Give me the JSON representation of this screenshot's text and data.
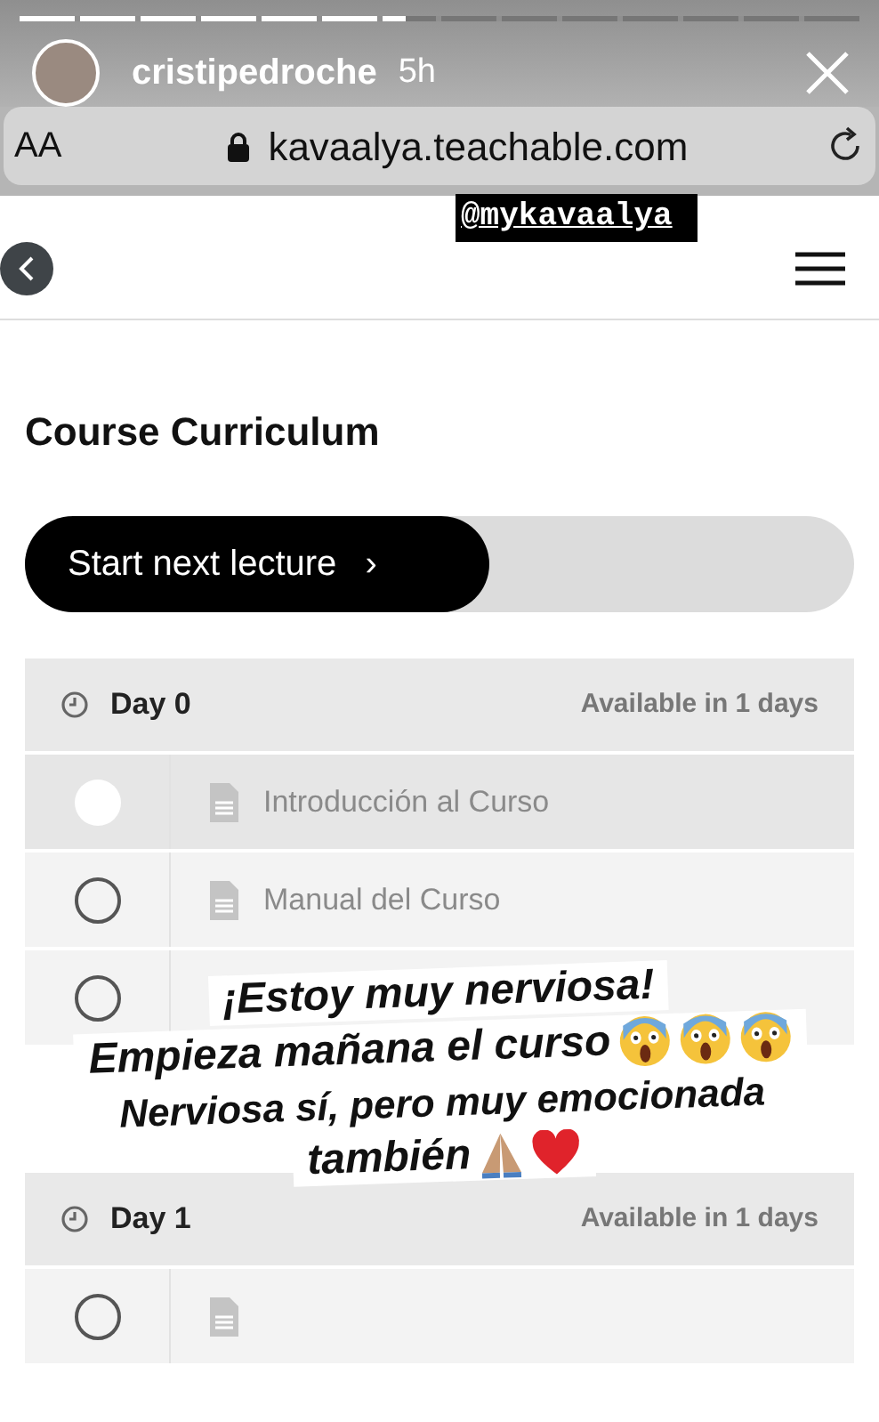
{
  "story": {
    "progress": {
      "level": 0.46
    },
    "username": "cristipedroche",
    "time": "5h"
  },
  "browser": {
    "text_size": "AA",
    "url": "kavaalya.teachable.com"
  },
  "sticker": "@mykavaalya",
  "title": "Course Curriculum",
  "start_button": {
    "label": "Start next lecture",
    "arrow": "›",
    "level": 0.56
  },
  "sections": [
    {
      "name": "Day 0",
      "availability": "Available in 1 days",
      "lectures": [
        {
          "title": "Introducción al Curso",
          "selected": true
        },
        {
          "title": "Manual del Curso",
          "selected": false
        },
        {
          "selected": false
        }
      ]
    },
    {
      "name": "Day 1",
      "availability": "Available in 1 days",
      "lectures": [
        {
          "selected": false
        }
      ]
    }
  ],
  "caption": [
    "¡Estoy muy nerviosa!",
    "Empieza mañana el curso",
    "Nerviosa sí, pero muy emocionada",
    "también"
  ]
}
